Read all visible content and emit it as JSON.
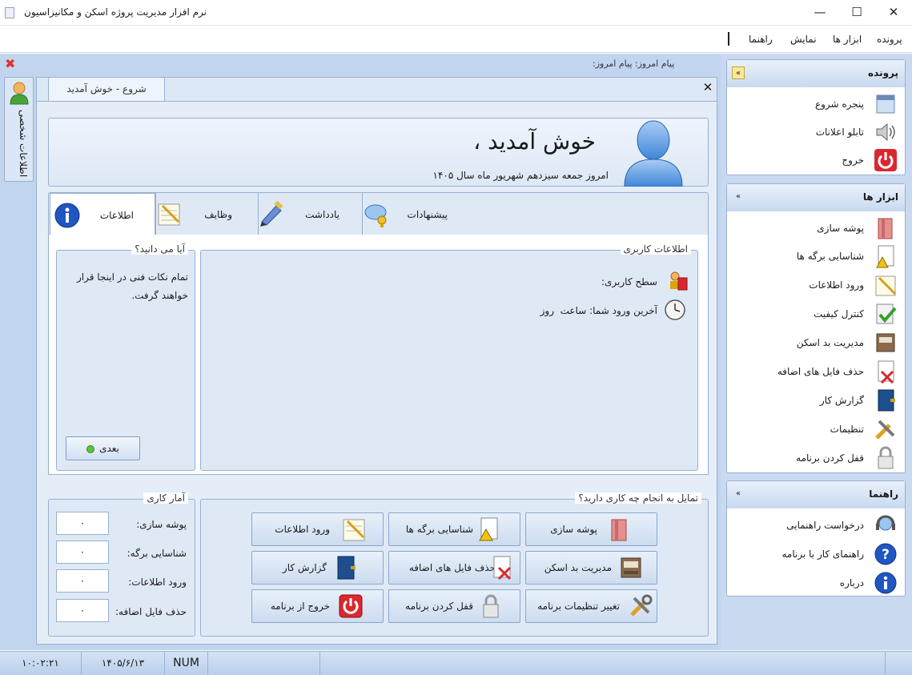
{
  "window": {
    "title": "نرم افزار مدیریت پروژه اسکن و مکانیزاسیون",
    "minimize": "—",
    "maximize": "☐",
    "close": "✕"
  },
  "menu": [
    "پرونده",
    "ابزار ها",
    "نمایش",
    "راهنما"
  ],
  "status_message": "پیام امروز:   پیام امروز:",
  "personal_tab_label": "اطلاعات شخصی",
  "doc_tab": {
    "label": "شروع - خوش آمدید"
  },
  "welcome": {
    "greeting": "خوش آمدید ،",
    "date": "امروز جمعه سیزدهم شهریور ماه سال ۱۴۰۵"
  },
  "inner_tabs": [
    {
      "label": "اطلاعات",
      "icon": "info-icon"
    },
    {
      "label": "وظایف",
      "icon": "notepad-icon"
    },
    {
      "label": "یادداشت",
      "icon": "pen-icon"
    },
    {
      "label": "پیشنهادات",
      "icon": "suggestion-icon"
    }
  ],
  "user_info": {
    "title": "اطلاعات کاربری",
    "level_label": "سطح کاربری:",
    "last_login": "آخرین ورود شما: ساعت  روز"
  },
  "did_you_know": {
    "title": "آیا می دانید؟",
    "text": "تمام نکات فنی در اینجا قرار خواهند گرفت.",
    "next_button": "بعدی"
  },
  "stats": {
    "title": "آمار کاری",
    "rows": [
      {
        "label": "پوشه سازی:",
        "value": "۰"
      },
      {
        "label": "شناسایی برگه:",
        "value": "۰"
      },
      {
        "label": "ورود اطلاعات:",
        "value": "۰"
      },
      {
        "label": "حذف فایل اضافه:",
        "value": "۰"
      }
    ]
  },
  "what_do": {
    "title": "تمایل به انجام چه کاری دارید؟",
    "buttons": [
      {
        "label": "پوشه سازی",
        "icon": "folder-icon"
      },
      {
        "label": "شناسایی برگه ها",
        "icon": "pages-warning-icon"
      },
      {
        "label": "ورود اطلاعات",
        "icon": "notepad-icon"
      },
      {
        "label": "مدیریت بد اسکن",
        "icon": "scanner-icon"
      },
      {
        "label": "حذف فایل های اضافه",
        "icon": "delete-file-icon"
      },
      {
        "label": "گزارش کار",
        "icon": "report-book-icon"
      },
      {
        "label": "تغییر تنظیمات برنامه",
        "icon": "tools-icon"
      },
      {
        "label": "قفل کردن برنامه",
        "icon": "lock-icon"
      },
      {
        "label": "خروج از برنامه",
        "icon": "power-icon"
      }
    ]
  },
  "side_panel": [
    {
      "title": "پرونده",
      "collapse": "«",
      "items": [
        {
          "label": "پنجره شروع",
          "icon": "start-window-icon"
        },
        {
          "label": "تابلو اعلانات",
          "icon": "speaker-icon"
        },
        {
          "label": "خروج",
          "icon": "power-icon"
        }
      ]
    },
    {
      "title": "ابزار ها",
      "collapse": "«",
      "items": [
        {
          "label": "پوشه سازی",
          "icon": "folder-icon"
        },
        {
          "label": "شناسایی برگه ها",
          "icon": "pages-warning-icon"
        },
        {
          "label": "ورود اطلاعات",
          "icon": "notepad-icon"
        },
        {
          "label": "کنترل کیفیت",
          "icon": "checklist-icon"
        },
        {
          "label": "مدیریت بد اسکن",
          "icon": "scanner-icon"
        },
        {
          "label": "حذف فایل های اضافه",
          "icon": "delete-file-icon"
        },
        {
          "label": "گزارش کار",
          "icon": "report-book-icon"
        },
        {
          "label": "تنظیمات",
          "icon": "tools-icon"
        },
        {
          "label": "قفل کردن برنامه",
          "icon": "lock-icon"
        }
      ]
    },
    {
      "title": "راهنما",
      "collapse": "«",
      "items": [
        {
          "label": "درخواست راهنمایی",
          "icon": "headset-icon"
        },
        {
          "label": "راهنمای کار با برنامه",
          "icon": "help-icon"
        },
        {
          "label": "درباره",
          "icon": "info-icon"
        }
      ]
    }
  ],
  "statusbar": {
    "time": "۱۰:۰۲:۲۱",
    "date": "۱۴۰۵/۶/۱۳",
    "num": "NUM"
  },
  "colors": {
    "workspace": "#c2d5ee",
    "panel": "#dfe9f6",
    "border": "#98b0cf",
    "accent_red": "#d9282f",
    "accent_blue": "#1f56c2"
  }
}
